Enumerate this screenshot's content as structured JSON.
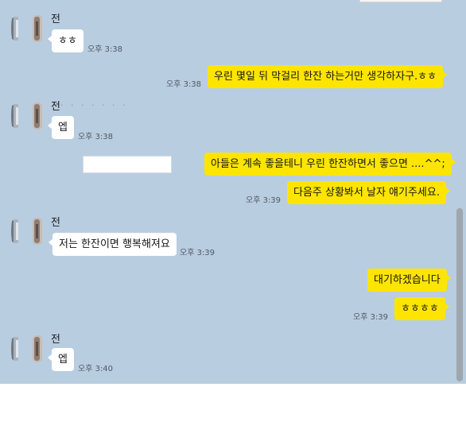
{
  "messages": [
    {
      "sender": "전",
      "text": "ㅎㅎ",
      "time": "오후 3:38"
    },
    {
      "text": "우린 몇일 뒤  막걸리 한잔 하는거만 생각하자구.ㅎㅎ",
      "time": "오후 3:38"
    },
    {
      "sender": "전",
      "text": "엡",
      "time": "오후 3:38"
    },
    {
      "text": "아들은 계속 좋을테니  우린 한잔하면서 좋으면 ....^^;"
    },
    {
      "text": "다음주 상황봐서 날자 얘기주세요.",
      "time": "오후 3:39"
    },
    {
      "sender": "전",
      "text": "저는 한잔이면 행복해져요",
      "time": "오후 3:39"
    },
    {
      "text": "대기하겠습니다"
    },
    {
      "text": "ㅎㅎㅎㅎ",
      "time": "오후 3:39"
    },
    {
      "sender": "전",
      "text": "엡",
      "time": "오후 3:40"
    }
  ],
  "colors": {
    "chat_bg": "#b9cde0",
    "incoming_bubble": "#ffffff",
    "outgoing_bubble": "#fee500"
  },
  "icons": {
    "avatar": "profile-photo-icon"
  }
}
